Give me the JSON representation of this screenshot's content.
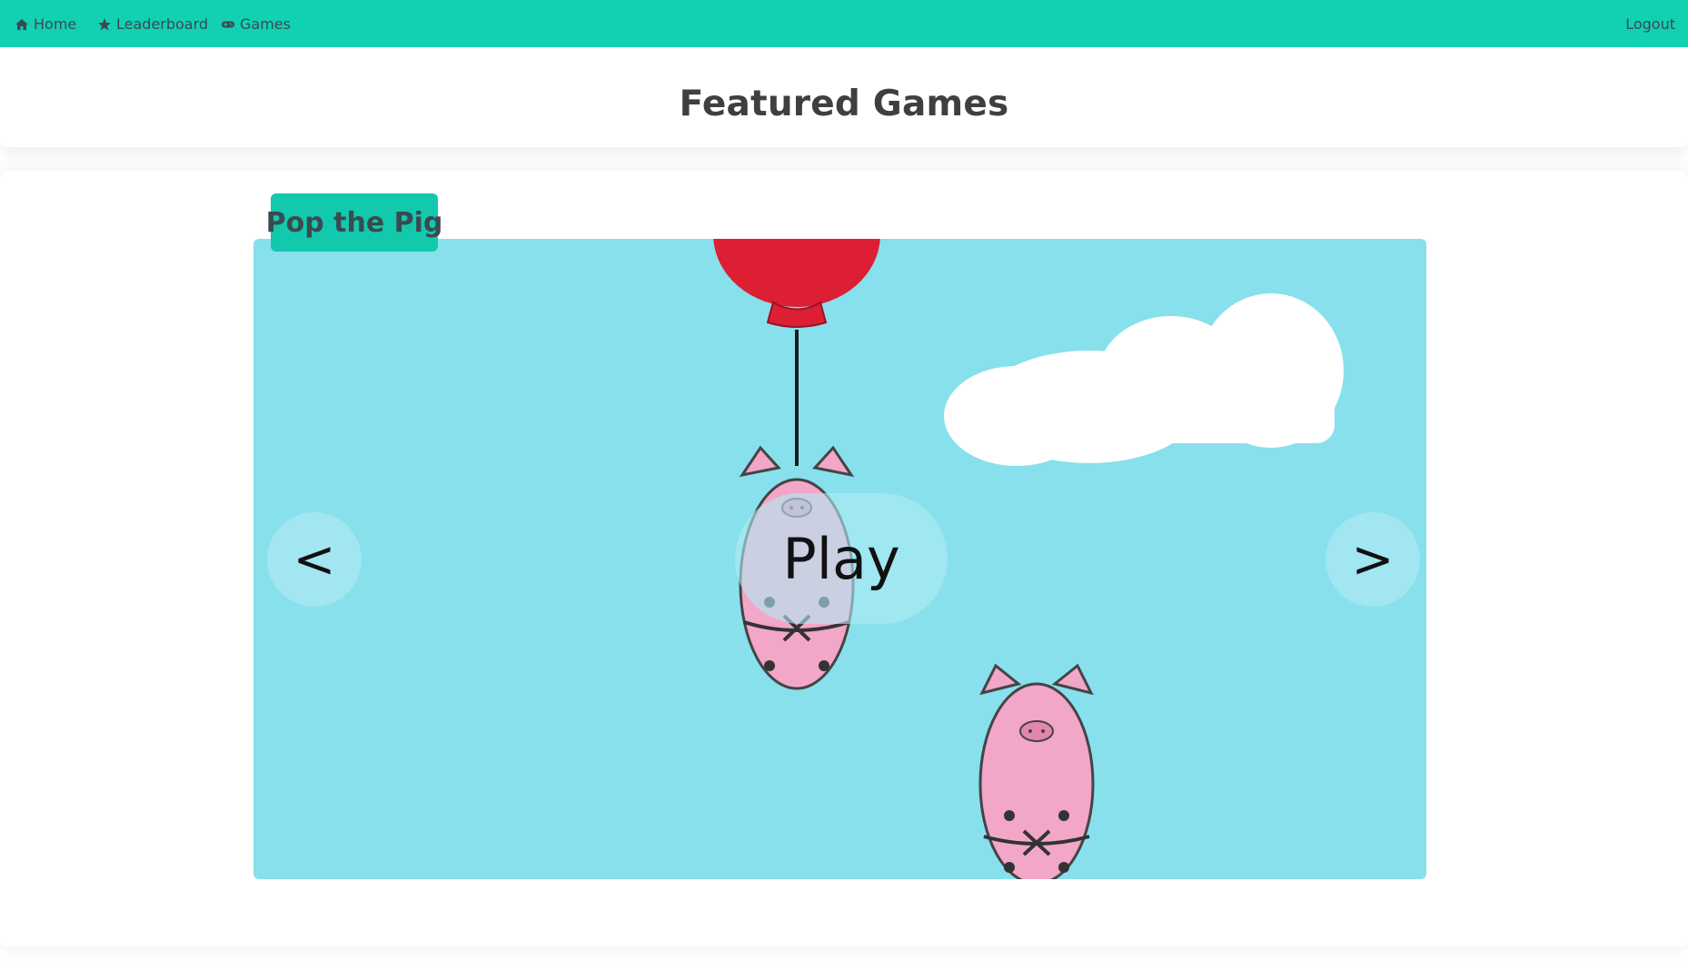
{
  "nav": {
    "items": [
      {
        "label": "Home",
        "icon": "home-icon"
      },
      {
        "label": "Leaderboard",
        "icon": "star-icon"
      },
      {
        "label": "Games",
        "icon": "gamepad-icon"
      }
    ],
    "logout_label": "Logout"
  },
  "header": {
    "title": "Featured Games"
  },
  "carousel": {
    "game_title": "Pop the Pig",
    "prev_label": "<",
    "next_label": ">",
    "play_label": "Play"
  },
  "colors": {
    "accent": "#12d1b2",
    "sky": "#88e0ed",
    "balloon": "#dd1f34",
    "pig": "#f2a6c8"
  }
}
